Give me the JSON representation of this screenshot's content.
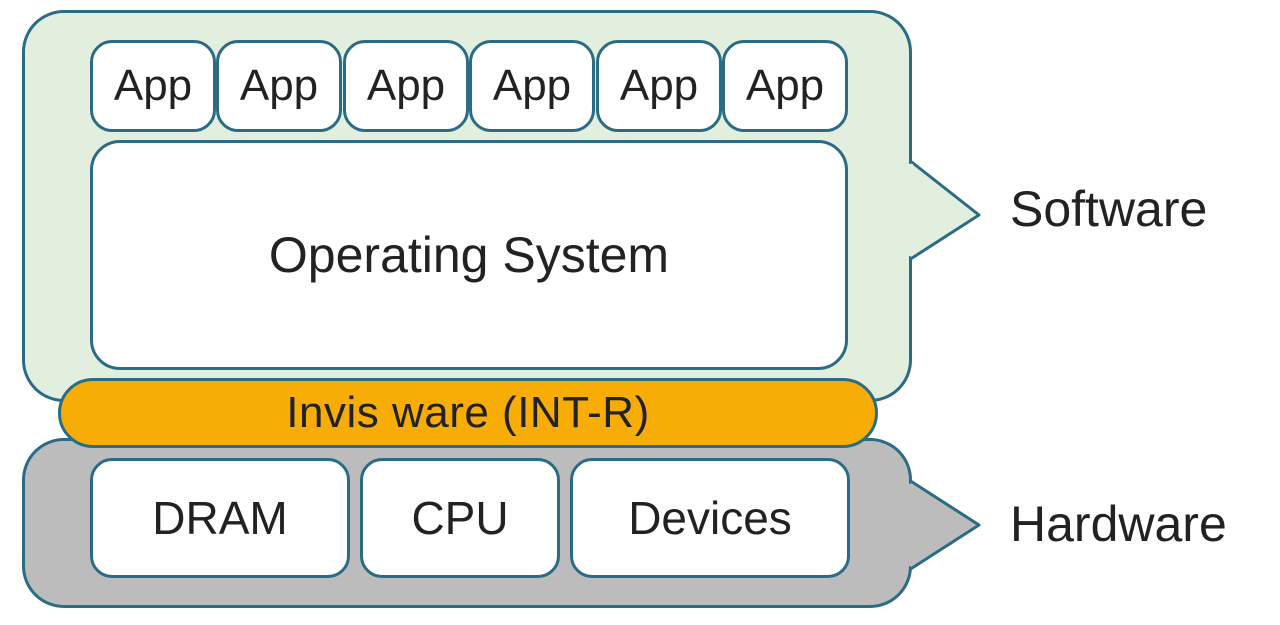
{
  "software": {
    "label": "Software",
    "apps": [
      "App",
      "App",
      "App",
      "App",
      "App",
      "App"
    ],
    "os_label": "Operating System"
  },
  "middle": {
    "label": "Invis ware (INT-R)"
  },
  "hardware": {
    "label": "Hardware",
    "components": [
      "DRAM",
      "CPU",
      "Devices"
    ]
  },
  "colors": {
    "border": "#2a6b86",
    "software_bg": "#e3efde",
    "hardware_bg": "#bcbcbc",
    "middle_bg": "#f8ad06",
    "box_bg": "#ffffff"
  }
}
